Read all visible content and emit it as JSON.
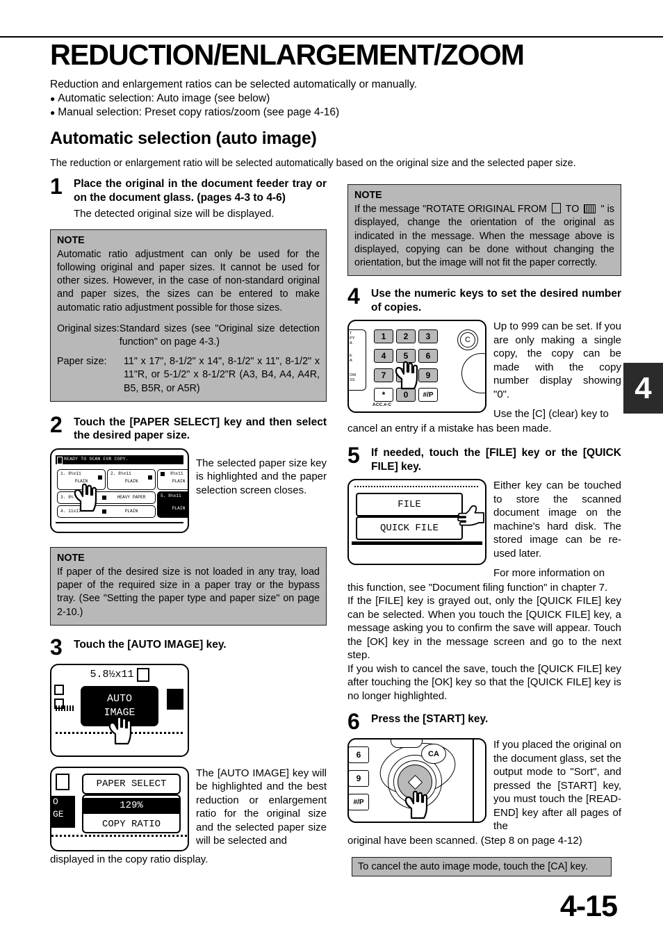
{
  "header": {
    "title": "REDUCTION/ENLARGEMENT/ZOOM",
    "lead": "Reduction and enlargement ratios can be selected automatically or manually.",
    "bullets": [
      "Automatic selection: Auto image (see below)",
      "Manual selection: Preset copy ratios/zoom (see page 4-16)"
    ],
    "subtitle": "Automatic selection (auto image)",
    "subtitle_lead": "The reduction or enlargement ratio will be selected automatically based on the original size and the selected paper size."
  },
  "steps": {
    "s1": {
      "num": "1",
      "title": "Place the original in the document feeder tray or on the document glass. (pages 4-3 to 4-6)",
      "body": "The detected original size will be displayed."
    },
    "s2": {
      "num": "2",
      "title": "Touch the [PAPER SELECT] key and then select the desired paper size.",
      "side": "The selected paper size key is highlighted and the paper selection screen closes."
    },
    "s3": {
      "num": "3",
      "title": "Touch the [AUTO IMAGE] key.",
      "side": "The [AUTO IMAGE] key will be highlighted and the best reduction or enlargement ratio for the original size and the selected paper size will be selected and",
      "side_tail": "displayed in the copy ratio display."
    },
    "s4": {
      "num": "4",
      "title": "Use the numeric keys to set the desired number of copies.",
      "side": "Up to 999 can be set. If you are only making a single copy, the copy can be made with the copy number display showing \"0\".",
      "side2": "Use the [C] (clear) key to",
      "tail": "cancel an entry if a mistake has been made."
    },
    "s5": {
      "num": "5",
      "title": "If needed, touch the [FILE] key or the [QUICK FILE] key.",
      "side": "Either key can be touched to store the scanned document image on the machine's hard disk. The stored image can be re-used later.",
      "side2": "For more information on",
      "tail": "this function, see \"Document filing function\" in chapter 7.",
      "para2": "If the [FILE] key is grayed out, only the [QUICK FILE] key can be selected. When you touch the [QUICK FILE] key, a message asking you to confirm the save will appear. Touch the [OK] key in the message screen and go to the next step.",
      "para3": "If you wish to cancel the save, touch the [QUICK FILE] key after touching the [OK] key so that the [QUICK FILE] key is no longer highlighted."
    },
    "s6": {
      "num": "6",
      "title": "Press the [START] key.",
      "side": "If you placed the original on the document glass, set the output mode to \"Sort\", and pressed the [START] key, you must touch the [READ-END] key after all pages of the",
      "tail": "original have been scanned. (Step 8 on page 4-12)"
    }
  },
  "notes": {
    "note_label": "NOTE",
    "note1": {
      "body": "Automatic ratio adjustment can only be used for the following original and paper sizes. It cannot be used for other sizes. However, in the case of non-standard original and paper sizes, the sizes can be entered to make automatic ratio adjustment possible for those sizes.",
      "row1_key": "Original sizes:",
      "row1_val": "Standard sizes (see \"Original size detection function\" on page 4-3.)",
      "row2_key": "Paper size:",
      "row2_val": "11\" x 17\", 8-1/2\" x 14\", 8-1/2\" x 11\", 8-1/2\" x 11\"R, or 5-1/2\" x 8-1/2\"R (A3, B4, A4, A4R, B5, B5R, or A5R)"
    },
    "note2": {
      "body_a": "If paper of the desired size is not loaded in any tray, load paper of the required size in a paper tray or the bypass tray. (See \"Setting the paper type and paper size\" on page 2-10.)"
    },
    "note3": {
      "pre": "If the message \"ROTATE ORIGINAL FROM",
      "mid": "TO",
      "post": "\" is displayed, change the orientation of the original as indicated in the message. When the message above is displayed, copying can be done without changing the orientation, but the image will not fit the paper correctly."
    }
  },
  "cancel_banner": "To cancel the auto image mode, touch the [CA] key.",
  "page_number": "4-15",
  "chapter_tab": "4",
  "lcd_paper_select": {
    "status": "READY TO SCAN FOR COPY.",
    "keys": [
      {
        "label": "1. 8½x11",
        "type": "PLAIN"
      },
      {
        "label": "2. 8½x11",
        "type": "PLAIN"
      },
      {
        "label": "8½x11",
        "type": "PLAIN"
      },
      {
        "label": "3. 8½",
        "type": "HEAVY PAPER"
      },
      {
        "label": "4. 11x17",
        "type": "PLAIN"
      },
      {
        "label": "5. 8½x11",
        "type": "PLAIN"
      }
    ]
  },
  "lcd_auto_image": {
    "size_label": "5.8½x11",
    "key_line1": "AUTO",
    "key_line2": "IMAGE"
  },
  "lcd_copy_ratio": {
    "paper_select": "PAPER SELECT",
    "ratio_value": "129%",
    "ratio_label": "COPY RATIO",
    "side_line1": "O",
    "side_line2": "GE"
  },
  "keypad": {
    "keys": [
      "1",
      "2",
      "3",
      "4",
      "5",
      "6",
      "7",
      "8",
      "9",
      "*",
      "0",
      "#/P"
    ],
    "clear": "C",
    "acc": "ACC.#-C",
    "left_labels": [
      "T",
      "PY",
      "A",
      "E",
      "A",
      "OM",
      "SS"
    ]
  },
  "lcd_file": {
    "file": "FILE",
    "quick_file": "QUICK FILE"
  },
  "start_panel": {
    "ca": "CA",
    "side_keys": [
      "6",
      "9",
      "#/P"
    ]
  },
  "colors": {
    "note_bg": "#b8b8b8",
    "tab_bg": "#2b2b2b",
    "key_gray": "#b9b9b9"
  }
}
